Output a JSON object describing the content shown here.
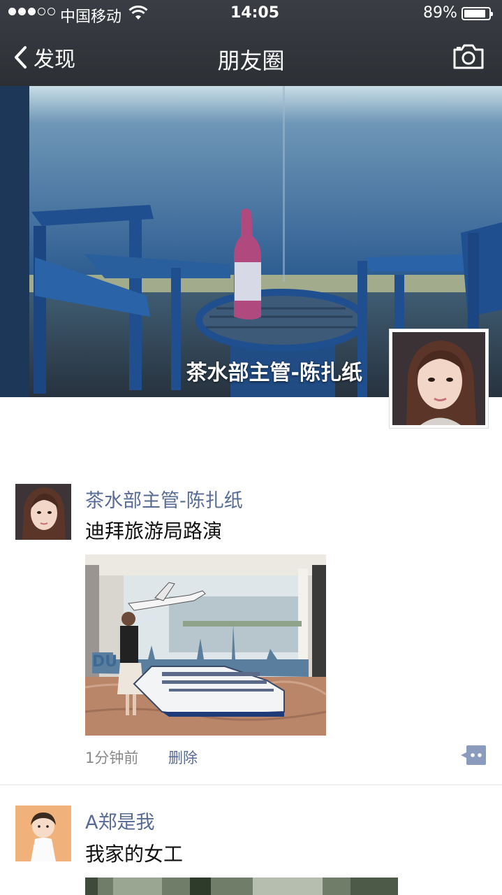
{
  "status_bar": {
    "carrier": "中国移动",
    "time": "14:05",
    "battery_percent_text": "89%",
    "battery_level": 0.89,
    "signal_bars_filled": 3,
    "signal_bars_total": 5
  },
  "nav": {
    "back_label": "发现",
    "title": "朋友圈",
    "camera_icon": "camera-icon"
  },
  "cover": {
    "owner_name": "茶水部主管-陈扎纸"
  },
  "posts": [
    {
      "author": "茶水部主管-陈扎纸",
      "text": "迪拜旅游局路演",
      "time": "1分钟前",
      "delete_label": "删除"
    },
    {
      "author": "A郑是我",
      "text": "我家的女工"
    }
  ],
  "colors": {
    "link": "#576b95",
    "nav_bg": "#2c3035",
    "comment_button": "#8a9bbd"
  }
}
